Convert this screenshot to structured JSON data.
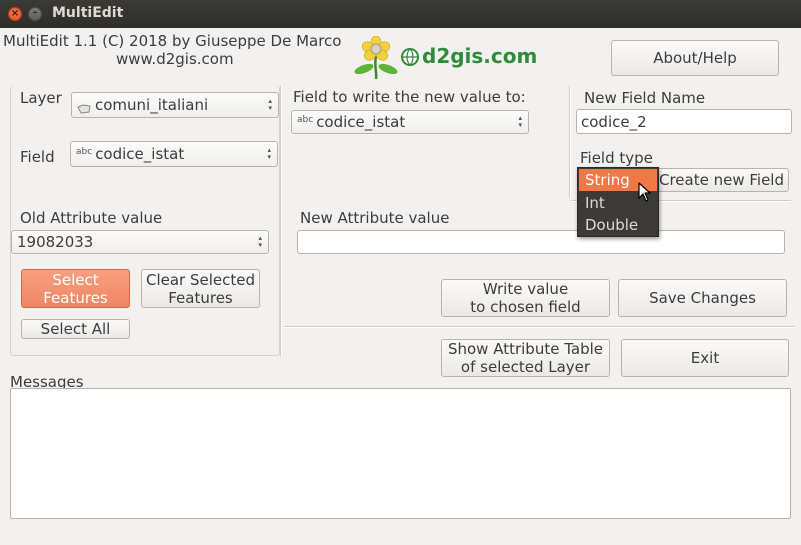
{
  "window": {
    "title": "MultiEdit"
  },
  "header": {
    "credit_line1": "MultiEdit 1.1  (C) 2018 by Giuseppe De Marco",
    "credit_line2": "www.d2gis.com",
    "logo_text": "d2gis.com",
    "about_button": "About/Help"
  },
  "left_panel": {
    "layer_label": "Layer",
    "layer_value": "comuni_italiani",
    "field_label": "Field",
    "field_value": "codice_istat",
    "old_value_label": "Old Attribute value",
    "old_value": "19082033",
    "select_features_button_l1": "Select",
    "select_features_button_l2": "Features",
    "clear_selected_button_l1": "Clear Selected",
    "clear_selected_button_l2": "Features",
    "select_all_button": "Select All"
  },
  "middle_panel": {
    "field_to_write_label": "Field to write the new value to:",
    "field_to_write_value": "codice_istat",
    "new_value_label": "New Attribute value",
    "new_value": "",
    "write_value_button_l1": "Write value",
    "write_value_button_l2": "to chosen field",
    "save_changes_button": "Save Changes",
    "show_table_button_l1": "Show Attribute Table",
    "show_table_button_l2": "of selected Layer",
    "exit_button": "Exit"
  },
  "right_panel": {
    "new_field_name_label": "New Field Name",
    "new_field_name_value": "codice_2",
    "field_type_label": "Field type",
    "create_field_button": "Create new Field",
    "field_type_options": [
      "String",
      "Int",
      "Double"
    ],
    "field_type_selected": "String"
  },
  "messages": {
    "label": "Messages",
    "content": ""
  },
  "colors": {
    "accent": "#f07746",
    "button_primary": "#ef8662",
    "titlebar": "#3b3a36"
  }
}
